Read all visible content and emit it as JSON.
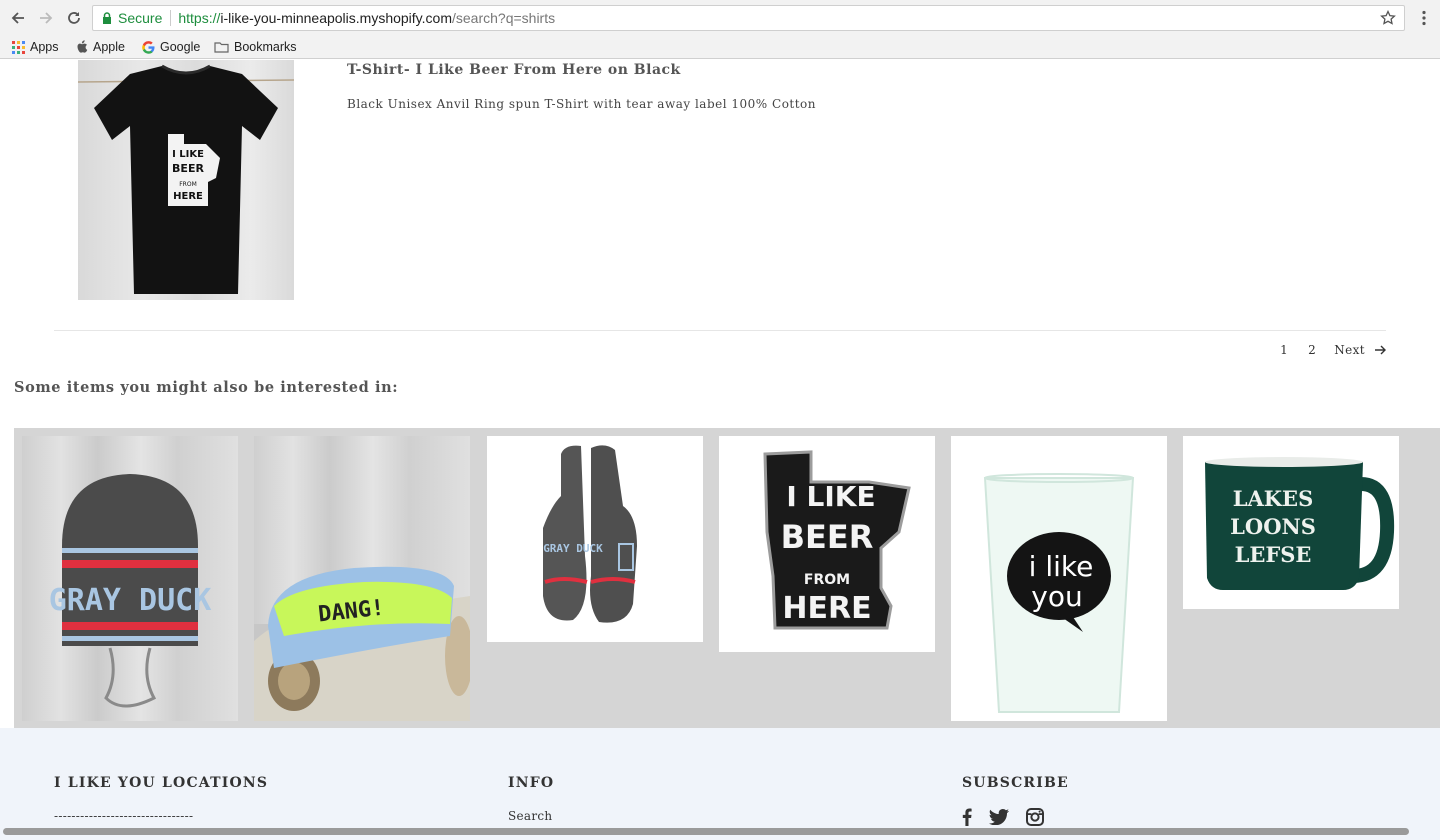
{
  "browser": {
    "secure_label": "Secure",
    "url_origin": "https://",
    "url_host": "i-like-you-minneapolis.myshopify.com",
    "url_path": "/search?q=shirts",
    "bookmarks": [
      "Apps",
      "Apple",
      "Google",
      "Bookmarks"
    ]
  },
  "result": {
    "title": "T-Shirt- I Like Beer From Here on Black",
    "description": "Black Unisex Anvil Ring spun T-Shirt with tear away label 100% Cotton",
    "shirt_text": [
      "I LIKE",
      "BEER",
      "FROM",
      "HERE"
    ]
  },
  "pagination": {
    "pages": [
      "1",
      "2"
    ],
    "next_label": "Next"
  },
  "recommendations": {
    "heading": "Some items you might also be interested in:",
    "items": [
      {
        "icon": "gray-duck-beanie",
        "text": "GRAY DUCK"
      },
      {
        "icon": "dang-headband",
        "text": "DANG!"
      },
      {
        "icon": "gray-duck-mittens",
        "text": "GRAY DUCK"
      },
      {
        "icon": "i-like-beer-patch",
        "text": [
          "I LIKE",
          "BEER",
          "FROM",
          "HERE"
        ]
      },
      {
        "icon": "i-like-you-pint-glass",
        "text": [
          "i like",
          "you"
        ]
      },
      {
        "icon": "lakes-loons-lefse-mug",
        "text": [
          "LAKES",
          "LOONS",
          "LEFSE"
        ]
      }
    ]
  },
  "footer": {
    "locations_heading": "I LIKE YOU LOCATIONS",
    "locations_divider": "--------------------------------",
    "info_heading": "INFO",
    "info_link": "Search",
    "subscribe_heading": "SUBSCRIBE",
    "social": [
      "facebook-icon",
      "twitter-icon",
      "instagram-icon"
    ]
  },
  "colors": {
    "secure_green": "#1e8e3e",
    "recs_background": "#d5d5d5",
    "footer_background": "#f0f4fa",
    "mug_green": "#11453a",
    "beanie_stripe_red": "#e0303f",
    "headband_lime": "#c8f75a"
  }
}
